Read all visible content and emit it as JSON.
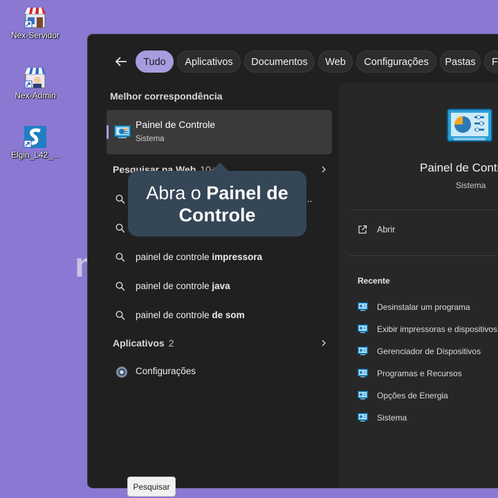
{
  "desktop": {
    "icons": [
      {
        "label": "Nex-Servidor",
        "icon": "nex-store-icon"
      },
      {
        "label": "Nex-Admin",
        "icon": "nex-store-admin-icon"
      },
      {
        "label": "Elgin_L42_...",
        "icon": "elgin-s-icon"
      }
    ],
    "background_fragment": "n"
  },
  "search": {
    "tabs": [
      "Tudo",
      "Aplicativos",
      "Documentos",
      "Web",
      "Configurações",
      "Pastas",
      "F"
    ],
    "active_tab": "Tudo",
    "best_match": {
      "heading": "Melhor correspondência",
      "title": "Painel de Controle",
      "subtitle": "Sistema"
    },
    "web": {
      "heading": "Pesquisar na Web",
      "count": "10+",
      "items": [
        {
          "prefix": "painel de controle ",
          "bold": "impressora"
        },
        {
          "prefix": "painel de controle ",
          "bold": "java"
        },
        {
          "prefix": "painel de controle ",
          "bold": "de som"
        }
      ],
      "hidden_item_suffix": "..."
    },
    "apps": {
      "heading": "Aplicativos",
      "count": "2",
      "items": [
        {
          "label": "Configurações",
          "icon": "gear-icon"
        }
      ]
    },
    "preview": {
      "title": "Painel de Controle",
      "subtitle": "Sistema",
      "open_label": "Abrir",
      "recent_heading": "Recente",
      "recent": [
        "Desinstalar um programa",
        "Exibir impressoras e dispositivos",
        "Gerenciador de Dispositivos",
        "Programas e Recursos",
        "Opções de Energia",
        "Sistema"
      ]
    }
  },
  "callout": {
    "prefix": "Abra o ",
    "bold": "Painel de Controle"
  },
  "taskbar_tooltip": "Pesquisar",
  "colors": {
    "desktop_bg": "#8a78d2",
    "panel_bg": "#202020",
    "accent": "#a69de0",
    "callout_bg": "#354656"
  }
}
